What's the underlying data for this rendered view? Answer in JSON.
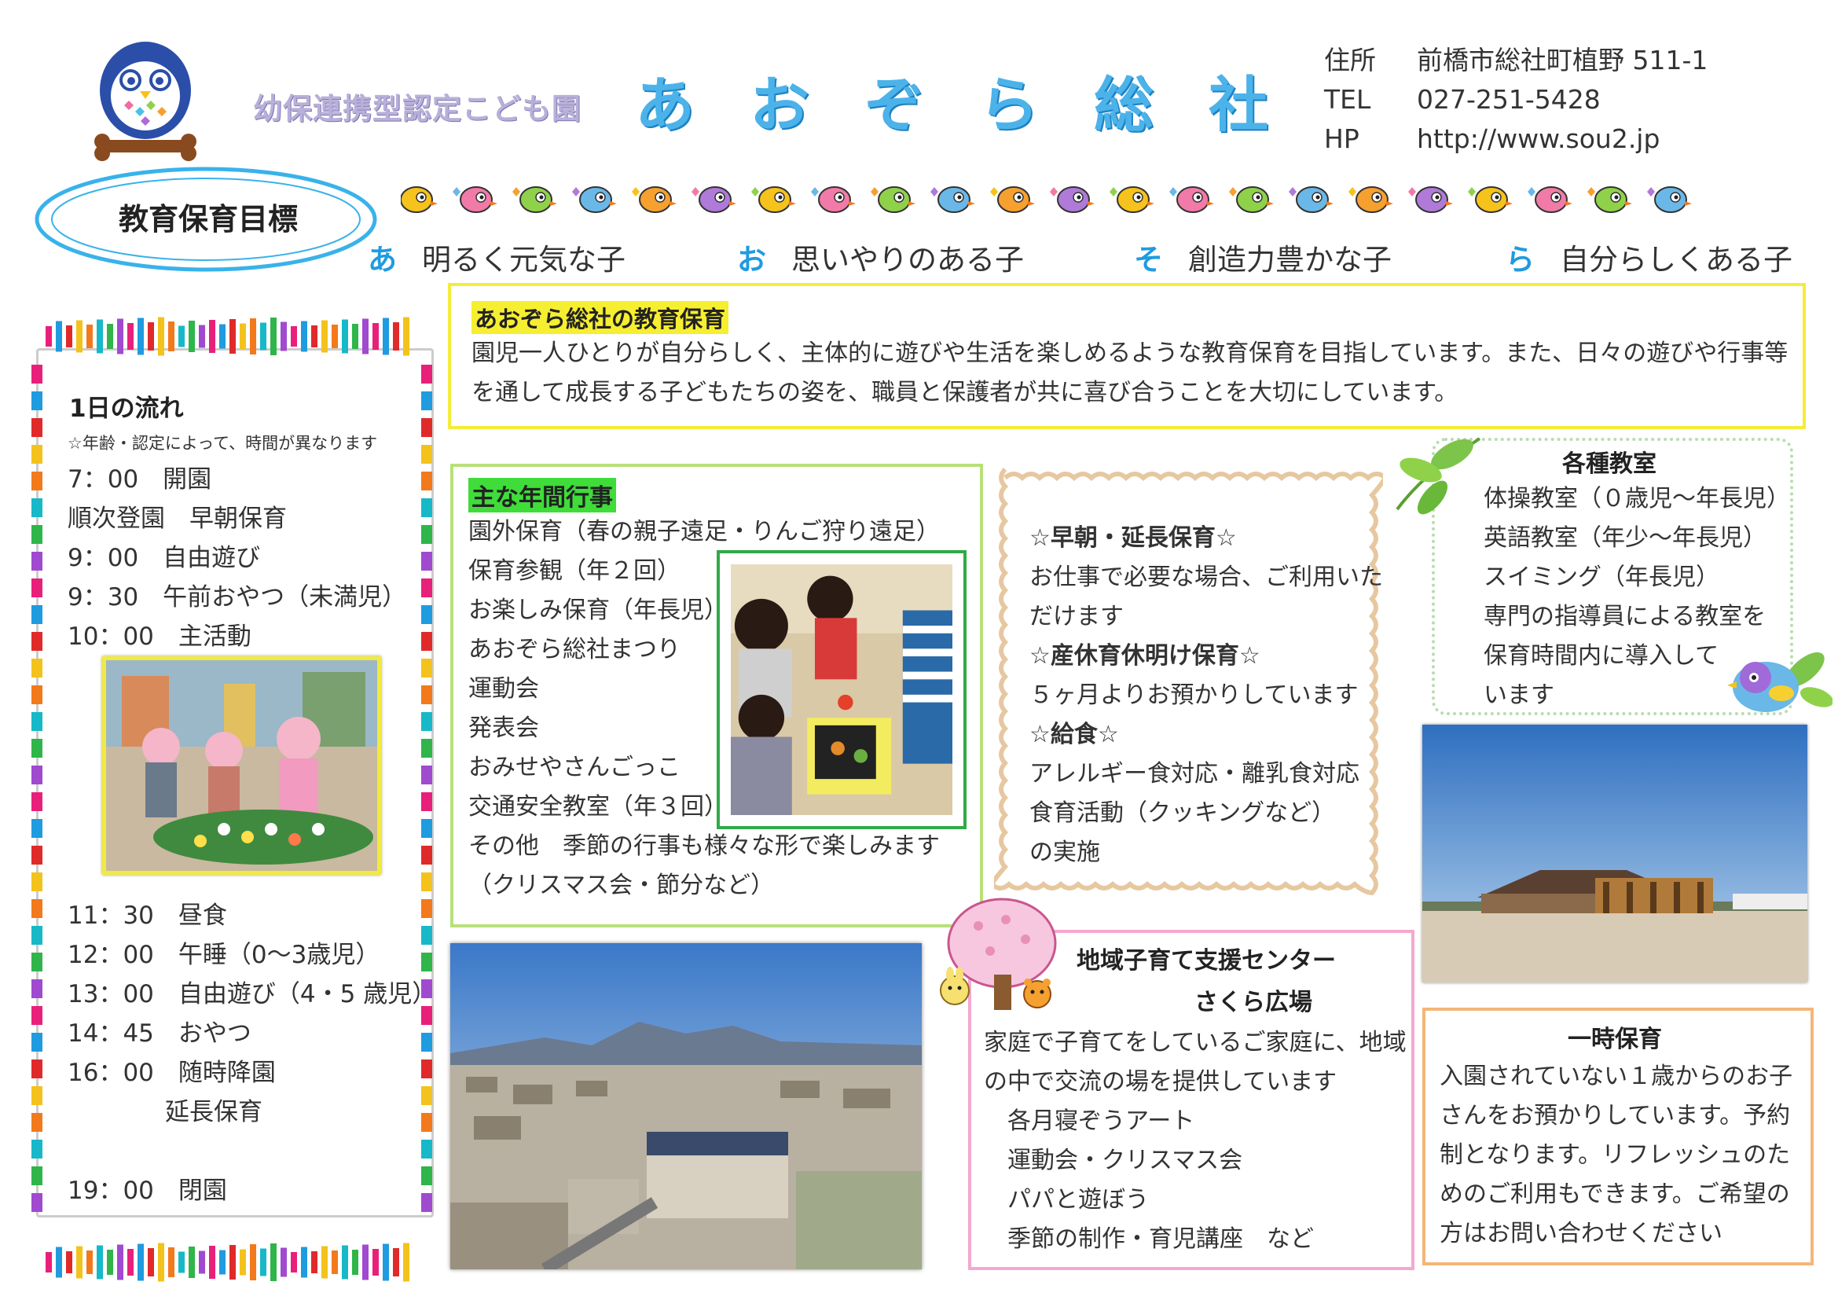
{
  "header": {
    "subtitle": "幼保連携型認定こども園",
    "title": "あおぞら総社",
    "contact": [
      {
        "label": "住所",
        "value": "前橋市総社町植野 511-1"
      },
      {
        "label": "TEL",
        "value": "027-251-5428"
      },
      {
        "label": "HP",
        "value": "http://www.sou2.jp"
      }
    ]
  },
  "goals": {
    "title": "教育保育目標",
    "items": [
      {
        "kana": "あ",
        "text": "明るく元気な子"
      },
      {
        "kana": "お",
        "text": "思いやりのある子"
      },
      {
        "kana": "そ",
        "text": "創造力豊かな子"
      },
      {
        "kana": "ら",
        "text": "自分らしくある子"
      }
    ]
  },
  "schedule": {
    "title": "1日の流れ",
    "note": "☆年齢・認定によって、時間が異なります",
    "items_top": [
      " 7：00　開園",
      "順次登園　早朝保育",
      " 9：00　自由遊び",
      " 9：30　午前おやつ（未満児）",
      "10：00　主活動"
    ],
    "items_bottom": [
      "11：30　昼食",
      "12：00　午睡（0～3歳児）",
      "13：00　自由遊び（4・5 歳児）",
      "14：45　おやつ",
      "16：00　随時降園",
      "　　　　延長保育",
      "",
      "19：00　閉園"
    ]
  },
  "education": {
    "title": "あおぞら総社の教育保育",
    "text": "園児一人ひとりが自分らしく、主体的に遊びや生活を楽しめるような教育保育を目指しています。また、日々の遊びや行事等を通して成長する子どもたちの姿を、職員と保護者が共に喜び合うことを大切にしています。"
  },
  "events": {
    "title": "主な年間行事",
    "items": [
      "園外保育（春の親子遠足・りんご狩り遠足）",
      "保育参観（年２回）",
      "お楽しみ保育（年長児）",
      "あおぞら総社まつり",
      "運動会",
      "発表会",
      "おみせやさんごっこ",
      "交通安全教室（年３回）",
      "その他　季節の行事も様々な形で楽しみます",
      "（クリスマス会・節分など）"
    ]
  },
  "care": {
    "lines": [
      {
        "text": "☆早朝・延長保育☆",
        "heading": true
      },
      {
        "text": "お仕事で必要な場合、ご利用いた",
        "heading": false
      },
      {
        "text": "だけます",
        "heading": false
      },
      {
        "text": "☆産休育休明け保育☆",
        "heading": true
      },
      {
        "text": "５ヶ月よりお預かりしています",
        "heading": false
      },
      {
        "text": "☆給食☆",
        "heading": true
      },
      {
        "text": "アレルギー食対応・離乳食対応",
        "heading": false
      },
      {
        "text": "食育活動（クッキングなど）",
        "heading": false
      },
      {
        "text": "の実施",
        "heading": false
      }
    ]
  },
  "classes": {
    "title": "各種教室",
    "items": [
      "体操教室（０歳児～年長児）",
      "英語教室（年少～年長児）",
      "スイミング（年長児）",
      "専門の指導員による教室を",
      "保育時間内に導入して",
      "います"
    ]
  },
  "support": {
    "title": "地域子育て支援センター",
    "subtitle": "さくら広場",
    "lines": [
      "家庭で子育てをしているご家庭に、地域",
      "の中で交流の場を提供しています"
    ],
    "activities": [
      "各月寝ぞうアート",
      "運動会・クリスマス会",
      "パパと遊ぼう",
      "季節の制作・育児講座　など"
    ]
  },
  "temporary": {
    "title": "一時保育",
    "text": "入園されていない１歳からのお子さんをお預かりしています。予約制となります。リフレッシュのためのご利用もできます。ご希望の方はお問い合わせください"
  },
  "colors": {
    "title_blue": "#4bb3ea",
    "goal_kana": "#1f9be0",
    "highlight_yellow": "#f6ee30",
    "highlight_green": "#3fdc3a",
    "frame_yellow": "#f4ec3a",
    "frame_green": "#b8e07a",
    "frame_pink": "#f4a8d0",
    "frame_orange": "#f4b678"
  }
}
